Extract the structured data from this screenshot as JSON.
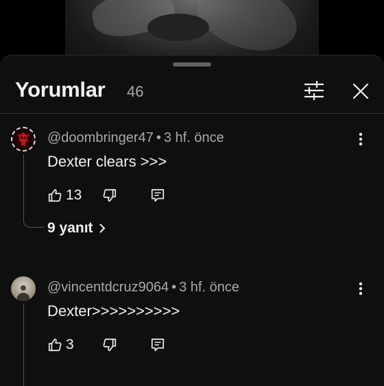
{
  "sheet": {
    "title": "Yorumlar",
    "count": "46"
  },
  "comments": [
    {
      "author": "@doombringer47",
      "separator": "•",
      "time": "3 hf. önce",
      "text": "Dexter clears >>>",
      "likes": "13",
      "replies_label": "9 yanıt"
    },
    {
      "author": "@vincentdcruz9064",
      "separator": "•",
      "time": "3 hf. önce",
      "text": "Dexter>>>>>>>>>>",
      "likes": "3"
    }
  ],
  "icons": {
    "filter": "sliders-icon",
    "close": "close-icon",
    "like": "thumb-up-icon",
    "dislike": "thumb-down-icon",
    "reply": "reply-icon",
    "more": "more-vertical-icon",
    "chevron": "chevron-right-icon"
  },
  "colors": {
    "background": "#0f0f0f",
    "text_primary": "#f1f1f1",
    "text_secondary": "#aaaaaa",
    "avatar_accent": "#c0141c"
  }
}
